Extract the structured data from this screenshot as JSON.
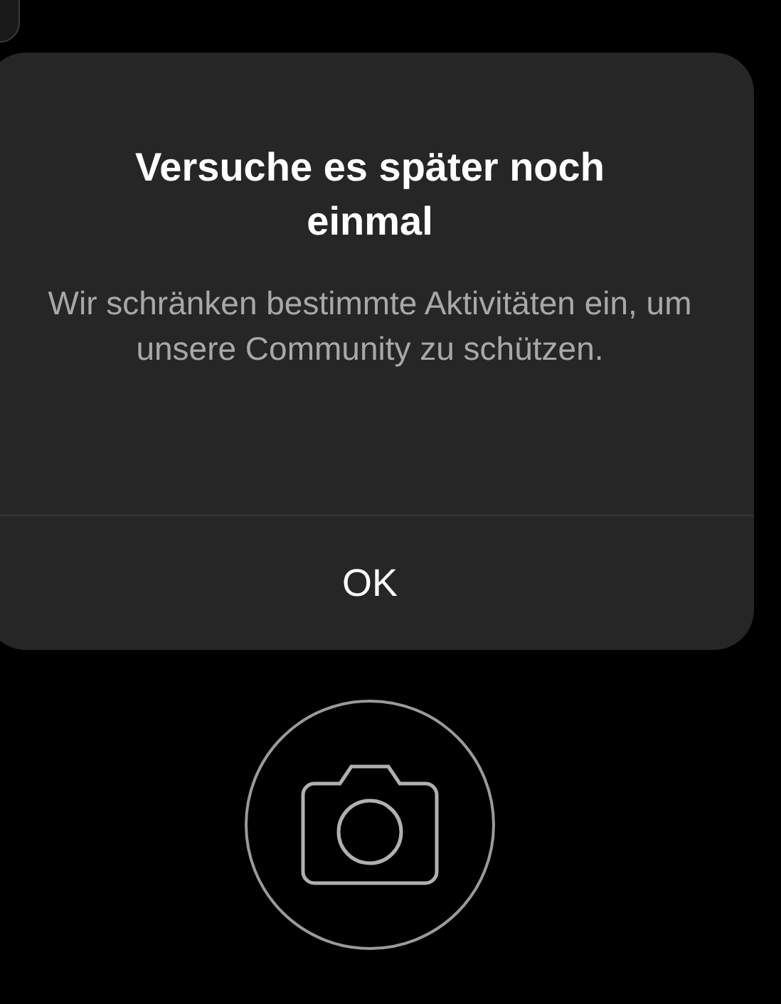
{
  "dialog": {
    "title": "Versuche es später noch einmal",
    "message": "Wir schränken bestimmte Aktivitäten ein, um unsere Community zu schützen.",
    "buttons": [
      "OK"
    ]
  }
}
